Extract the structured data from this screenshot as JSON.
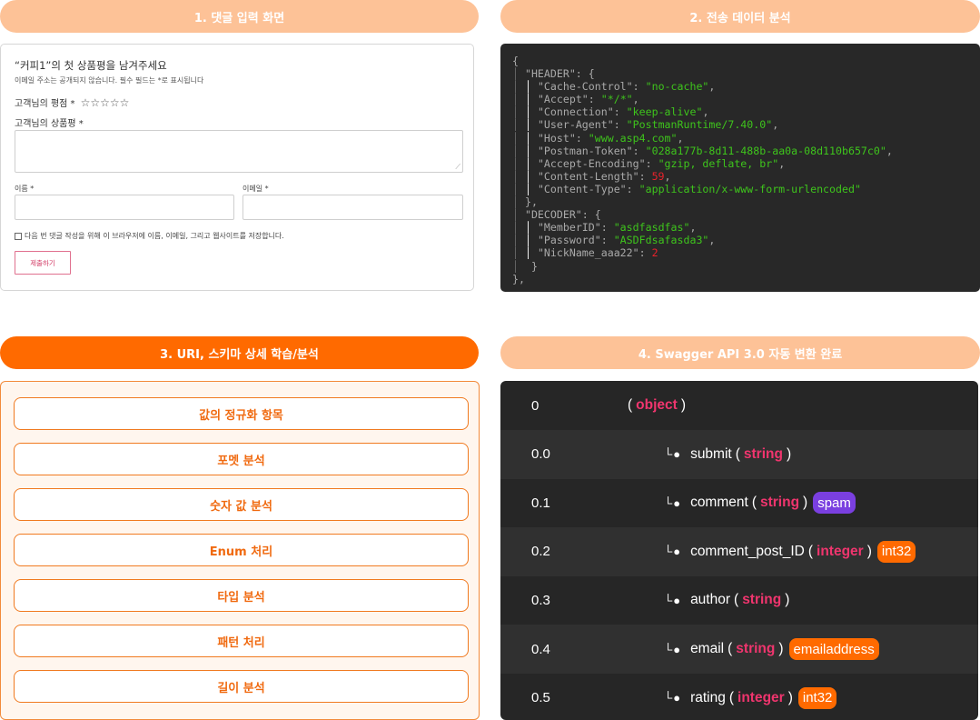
{
  "panels": {
    "p1": "1. 댓글 입력 화면",
    "p2": "2. 전송 데이터 분석",
    "p3": "3. URI, 스키마 상세 학습/분석",
    "p4": "4. Swagger API 3.0 자동 변환 완료"
  },
  "form": {
    "title": "“커피1”의 첫 상품평을 남겨주세요",
    "note": "이메일 주소는 공개되지 않습니다. 필수 필드는 *로 표시됩니다",
    "rating_label": "고객님의 평점 *",
    "stars": "☆☆☆☆☆",
    "review_label": "고객님의 상품평 *",
    "name_label": "이름 *",
    "email_label": "이메일 *",
    "save_label": "다음 번 댓글 작성을 위해 이 브라우저에 이름, 이메일, 그리고 웹사이트를 저장합니다.",
    "submit": "제출하기"
  },
  "code": {
    "open": "{",
    "header_key": "\"HEADER\"",
    "header_fields": [
      {
        "k": "\"Cache-Control\"",
        "v": "\"no-cache\"",
        "t": "s",
        "c": ","
      },
      {
        "k": "\"Accept\"",
        "v": "\"*/*\"",
        "t": "s",
        "c": ","
      },
      {
        "k": "\"Connection\"",
        "v": "\"keep-alive\"",
        "t": "s",
        "c": ","
      },
      {
        "k": "\"User-Agent\"",
        "v": "\"PostmanRuntime/7.40.0\"",
        "t": "s",
        "c": ","
      },
      {
        "k": "\"Host\"",
        "v": "\"www.asp4.com\"",
        "t": "s",
        "c": ","
      },
      {
        "k": "\"Postman-Token\"",
        "v": "\"028a177b-8d11-488b-aa0a-08d110b657c0\"",
        "t": "s",
        "c": ","
      },
      {
        "k": "\"Accept-Encoding\"",
        "v": "\"gzip, deflate, br\"",
        "t": "s",
        "c": ","
      },
      {
        "k": "\"Content-Length\"",
        "v": "59",
        "t": "n",
        "c": ","
      },
      {
        "k": "\"Content-Type\"",
        "v": "\"application/x-www-form-urlencoded\"",
        "t": "s",
        "c": ""
      }
    ],
    "header_close": "},",
    "decoder_key": "\"DECODER\"",
    "decoder_fields": [
      {
        "k": "\"MemberID\"",
        "v": "\"asdfasdfas\"",
        "t": "s",
        "c": ","
      },
      {
        "k": "\"Password\"",
        "v": "\"ASDFdsafasda3\"",
        "t": "s",
        "c": ","
      },
      {
        "k": "\"NickName_aaa22\"",
        "v": "2",
        "t": "n",
        "c": ""
      }
    ],
    "decoder_close": "}",
    "close": "},"
  },
  "analysis_items": [
    "값의 정규화 항목",
    "포멧 분석",
    "숫자 값 분석",
    "Enum 처리",
    "타입 분석",
    "패턴 처리",
    "길이 분석"
  ],
  "schema_rows": [
    {
      "idx": "0",
      "name": "",
      "type": "object",
      "badge": "",
      "badge_color": ""
    },
    {
      "idx": "0.0",
      "name": "submit",
      "type": "string",
      "badge": "",
      "badge_color": ""
    },
    {
      "idx": "0.1",
      "name": "comment",
      "type": "string",
      "badge": "spam",
      "badge_color": "#7a3fe0"
    },
    {
      "idx": "0.2",
      "name": "comment_post_ID",
      "type": "integer",
      "badge": "int32",
      "badge_color": "#ff6a00"
    },
    {
      "idx": "0.3",
      "name": "author",
      "type": "string",
      "badge": "",
      "badge_color": ""
    },
    {
      "idx": "0.4",
      "name": "email",
      "type": "string",
      "badge": "emailaddress",
      "badge_color": "#ff6a00"
    },
    {
      "idx": "0.5",
      "name": "rating",
      "type": "integer",
      "badge": "int32",
      "badge_color": "#ff6a00"
    }
  ],
  "tree_mark": "└●"
}
